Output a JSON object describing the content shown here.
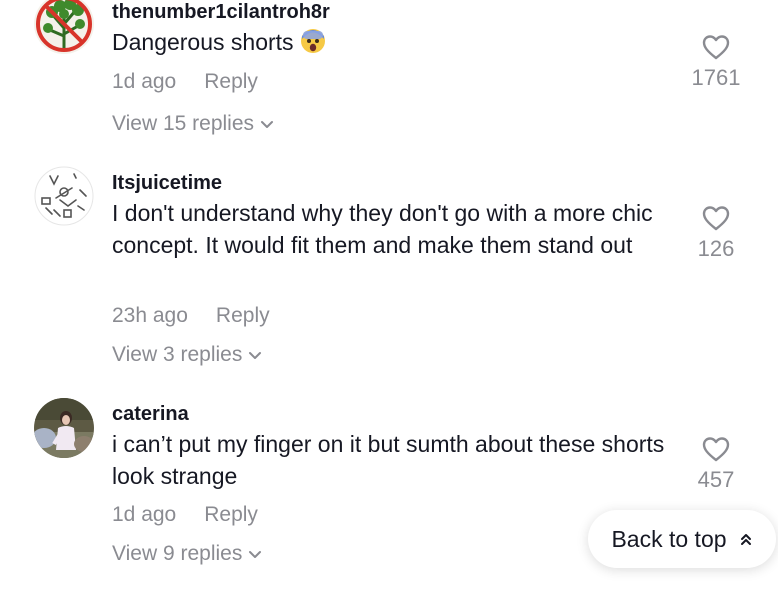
{
  "colors": {
    "primary_text": "#161823",
    "secondary_text": "#8a8b91",
    "background": "#ffffff"
  },
  "comments": [
    {
      "username": "thenumber1cilantroh8r",
      "text": "Dangerous shorts",
      "emoji_icon": "fearful-face-emoji-icon",
      "time": "1d ago",
      "reply_label": "Reply",
      "view_replies": "View 15 replies",
      "likes": "1761",
      "avatar_icon": "cilantro-banned-avatar"
    },
    {
      "username": "Itsjuicetime",
      "text": "I don't understand why they don't go with a more chic concept. It would fit them and make them stand out",
      "time": "23h ago",
      "reply_label": "Reply",
      "view_replies": "View 3 replies",
      "likes": "126",
      "avatar_icon": "doodle-avatar"
    },
    {
      "username": "caterina",
      "text": "i can’t put my finger on it but sumth about these shorts look strange",
      "time": "1d ago",
      "reply_label": "Reply",
      "view_replies": "View 9 replies",
      "likes": "457",
      "avatar_icon": "photo-avatar"
    }
  ],
  "back_to_top": {
    "label": "Back to top",
    "icon": "double-chevron-up-icon"
  }
}
